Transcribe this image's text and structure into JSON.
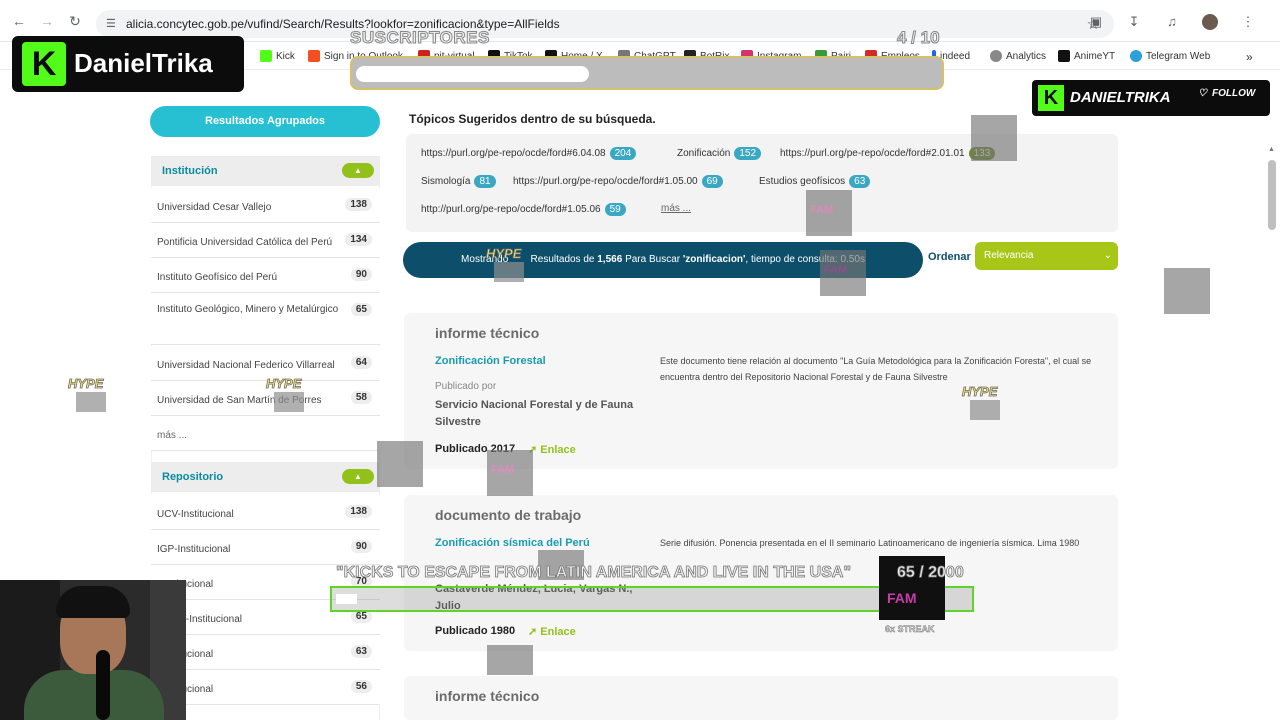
{
  "browser": {
    "url": "alicia.concytec.gob.pe/vufind/Search/Results?lookfor=zonificacion&type=AllFields",
    "bookmarks": [
      "Kick",
      "Sign in to Outlook",
      "pit-virtual",
      "TikTok",
      "Home / X",
      "ChatGPT",
      "BotRix",
      "Instagram",
      "Pairi",
      "Empleos",
      "indeed",
      "Analytics",
      "AnimeYT",
      "Telegram Web"
    ]
  },
  "overlay": {
    "brand": "DanielTrika",
    "brand_logo": "K",
    "subs_label": "SUSCRIPTORES",
    "subs_count": "4 / 10",
    "subs_progress": 0.4,
    "follow_name": "DANIELTRIKA",
    "follow_label": "FOLLOW",
    "hype": "HYPE",
    "fam": "FAM",
    "goal_text": "\"KICKS TO ESCAPE FROM LATIN AMERICA AND LIVE IN THE USA\"",
    "goal_count": "65 / 2000",
    "goal_progress": 0.0325,
    "streak": "6x STREAK"
  },
  "sidebar": {
    "grouped_button": "Resultados Agrupados",
    "institution": {
      "title": "Institución",
      "items": [
        {
          "name": "Universidad Cesar Vallejo",
          "count": "138"
        },
        {
          "name": "Pontificia Universidad Católica del Perú",
          "count": "134"
        },
        {
          "name": "Instituto Geofísico del Perú",
          "count": "90"
        },
        {
          "name": "Instituto Geológico, Minero y Metalúrgico",
          "count": "65"
        },
        {
          "name": "Universidad Nacional Federico Villarreal",
          "count": "64"
        },
        {
          "name": "Universidad de San Martín de Porres",
          "count": "58"
        }
      ],
      "more": "más ..."
    },
    "repository": {
      "title": "Repositorio",
      "items": [
        {
          "name": "UCV-Institucional",
          "count": "138"
        },
        {
          "name": "IGP-Institucional",
          "count": "90"
        },
        {
          "name": "-Institucional",
          "count": "70"
        },
        {
          "name": "MMET-Institucional",
          "count": "65"
        },
        {
          "name": "-Institucional",
          "count": "63"
        },
        {
          "name": "-Institucional",
          "count": "56"
        }
      ]
    }
  },
  "topics": {
    "title": "Tópicos Sugeridos dentro de su búsqueda.",
    "items": [
      {
        "label": "https://purl.org/pe-repo/ocde/ford#6.04.08",
        "count": "204"
      },
      {
        "label": "Zonificación",
        "count": "152"
      },
      {
        "label": "https://purl.org/pe-repo/ocde/ford#2.01.01",
        "count": "133"
      },
      {
        "label": "Sismología",
        "count": "81"
      },
      {
        "label": "https://purl.org/pe-repo/ocde/ford#1.05.00",
        "count": "69"
      },
      {
        "label": "Estudios geofísicos",
        "count": "63"
      },
      {
        "label": "http://purl.org/pe-repo/ocde/ford#1.05.06",
        "count": "59"
      }
    ],
    "more": "más ..."
  },
  "results": {
    "summary_prefix": "Mostrando",
    "summary_mid": "Resultados de",
    "total": "1,566",
    "summary_search": "Para Buscar",
    "query": "'zonificacion'",
    "summary_time": ", tiempo de consulta: 0.50s",
    "sort_label": "Ordenar",
    "sort_value": "Relevancia",
    "records": [
      {
        "type": "informe técnico",
        "title": "Zonificación Forestal",
        "description": "Este documento tiene relación al documento \"La Guía Metodológica para la Zonificación Foresta\", el cual se encuentra dentro del Repositorio Nacional Forestal y de Fauna Silvestre",
        "published_by_label": "Publicado por",
        "publisher": "Servicio Nacional Forestal y de Fauna Silvestre",
        "published": "Publicado 2017",
        "link": "Enlace"
      },
      {
        "type": "documento de trabajo",
        "title": "Zonificación sísmica del Perú",
        "description": "Serie difusión. Ponencia presentada en el II seminario Latinoamericano de ingeniería sísmica. Lima 1980",
        "authors": "Castaverde Méndez, Lucia; Vargas N., Julio",
        "published": "Publicado 1980",
        "link": "Enlace"
      },
      {
        "type": "informe técnico"
      }
    ]
  }
}
